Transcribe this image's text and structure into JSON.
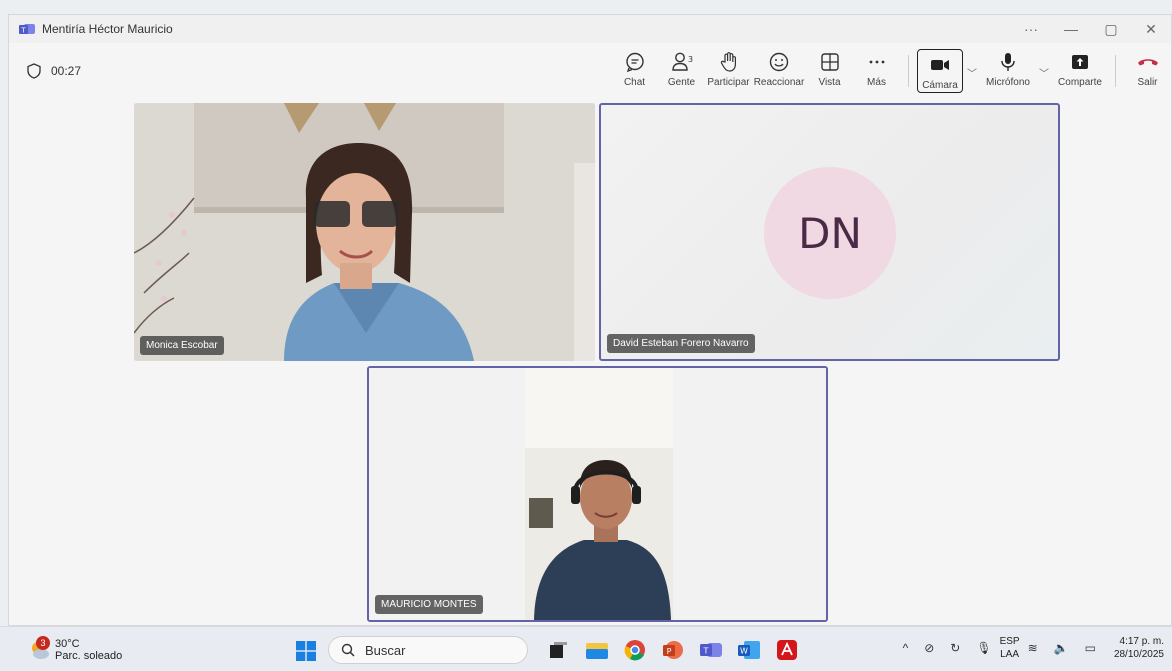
{
  "window": {
    "title": "Mentiría Héctor Mauricio",
    "controls": [
      "···",
      "—",
      "▢",
      "✕"
    ]
  },
  "meeting": {
    "timer": "00:27"
  },
  "toolbar": {
    "chat": "Chat",
    "people": "Gente",
    "people_count": "3",
    "raise_hand": "Participar",
    "react": "Reaccionar",
    "view": "Vista",
    "more": "Más",
    "camera": "Cámara",
    "mic": "Micrófono",
    "share": "Comparte",
    "leave": "Salir"
  },
  "participants": [
    {
      "name": "Monica Escobar"
    },
    {
      "name": "David Esteban Forero Navarro",
      "initials": "DN"
    },
    {
      "name": "MAURICIO MONTES"
    }
  ],
  "taskbar": {
    "weather_temp": "30°C",
    "weather_desc": "Parc. soleado",
    "weather_badge": "3",
    "search_placeholder": "Buscar",
    "lang_1": "ESP",
    "lang_2": "LAA",
    "time": "4:17 p. m.",
    "date": "28/10/2025"
  },
  "colors": {
    "accent": "#6264a7",
    "leave": "#c4314b"
  }
}
